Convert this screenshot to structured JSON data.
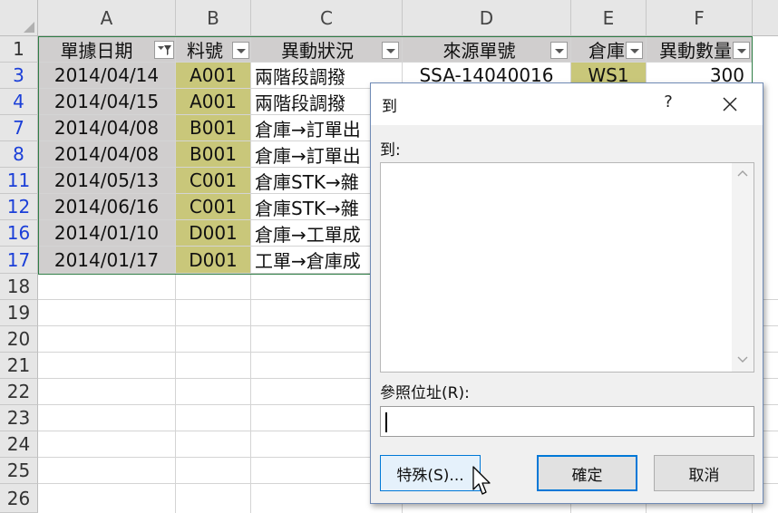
{
  "columns": [
    "A",
    "B",
    "C",
    "D",
    "E",
    "F"
  ],
  "header_row": {
    "row_number": "1",
    "cells": [
      "單據日期",
      "料號",
      "異動狀況",
      "來源單號",
      "倉庫",
      "異動數量"
    ]
  },
  "rows": [
    {
      "num": "3",
      "date": "2014/04/14",
      "item": "A001",
      "status": "兩階段調撥",
      "source": "SSA-14040016",
      "wh": "WS1",
      "qty": "300"
    },
    {
      "num": "4",
      "date": "2014/04/15",
      "item": "A001",
      "status": "兩階段調撥",
      "source": "",
      "wh": "",
      "qty": ""
    },
    {
      "num": "7",
      "date": "2014/04/08",
      "item": "B001",
      "status": "倉庫→訂單出",
      "source": "",
      "wh": "",
      "qty": ""
    },
    {
      "num": "8",
      "date": "2014/04/08",
      "item": "B001",
      "status": "倉庫→訂單出",
      "source": "",
      "wh": "",
      "qty": ""
    },
    {
      "num": "11",
      "date": "2014/05/13",
      "item": "C001",
      "status": "倉庫STK→雜",
      "source": "",
      "wh": "",
      "qty": ""
    },
    {
      "num": "12",
      "date": "2014/06/16",
      "item": "C001",
      "status": "倉庫STK→雜",
      "source": "",
      "wh": "",
      "qty": ""
    },
    {
      "num": "16",
      "date": "2014/01/10",
      "item": "D001",
      "status": "倉庫→工單成",
      "source": "",
      "wh": "",
      "qty": ""
    },
    {
      "num": "17",
      "date": "2014/01/17",
      "item": "D001",
      "status": "工單→倉庫成",
      "source": "",
      "wh": "",
      "qty": ""
    }
  ],
  "empty_rows": [
    "18",
    "19",
    "20",
    "21",
    "22",
    "23",
    "24",
    "25",
    "26"
  ],
  "dialog": {
    "title": "到",
    "help": "?",
    "goto_label": "到:",
    "reference_label": "參照位址(R):",
    "reference_value": "",
    "special_button": "特殊(S)...",
    "ok_button": "確定",
    "cancel_button": "取消"
  },
  "colors": {
    "header_fill": "#d0cece",
    "highlight_fill": "#c9c77a",
    "filtered_row_number": "#1b3fd8",
    "table_border": "#2e7d45",
    "accent": "#0078d7"
  },
  "icons": [
    "filter-dropdown-icon",
    "dropdown-arrow-icon",
    "close-icon",
    "scroll-up-icon",
    "scroll-down-icon",
    "mouse-pointer-icon"
  ]
}
